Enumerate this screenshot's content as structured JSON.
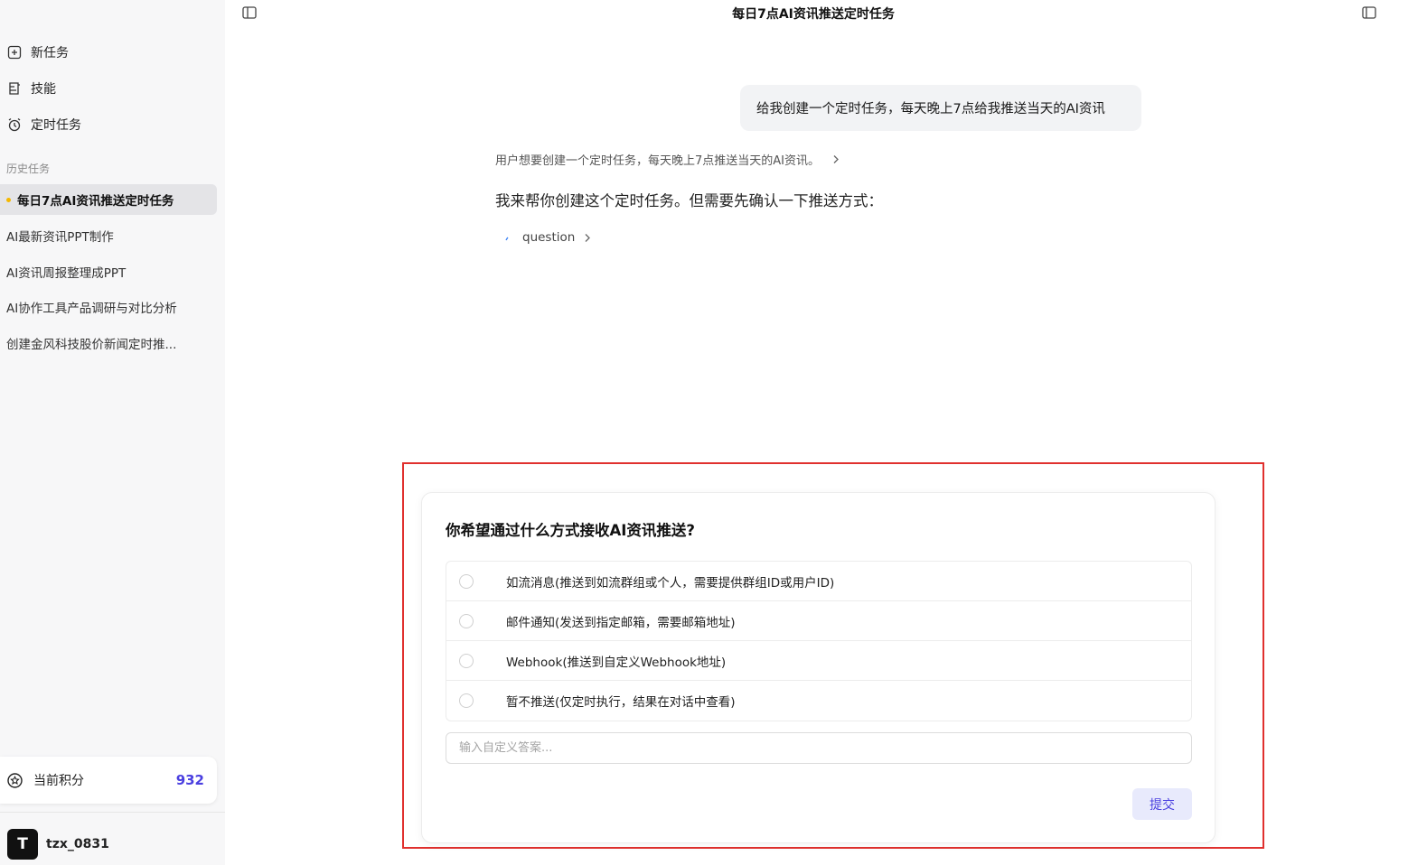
{
  "sidebar": {
    "nav": [
      {
        "label": "新任务",
        "icon": "plus-square-icon"
      },
      {
        "label": "技能",
        "icon": "skills-icon"
      },
      {
        "label": "定时任务",
        "icon": "alarm-clock-icon"
      }
    ],
    "history_label": "历史任务",
    "history": [
      {
        "label": "每日7点AI资讯推送定时任务",
        "active": true
      },
      {
        "label": "AI最新资讯PPT制作"
      },
      {
        "label": "AI资讯周报整理成PPT"
      },
      {
        "label": "AI协作工具产品调研与对比分析"
      },
      {
        "label": "创建金风科技股价新闻定时推..."
      }
    ],
    "points": {
      "label": "当前积分",
      "value": "932",
      "icon": "badge-star-icon"
    },
    "user": {
      "avatar_letter": "T",
      "name": "tzx_0831"
    }
  },
  "header": {
    "title": "每日7点AI资讯推送定时任务"
  },
  "chat": {
    "user_message": "给我创建一个定时任务，每天晚上7点给我推送当天的AI资讯",
    "thinking": "用户想要创建一个定时任务，每天晚上7点推送当天的AI资讯。",
    "reply": "我来帮你创建这个定时任务。但需要先确认一下推送方式：",
    "tool_label": "question"
  },
  "question_card": {
    "title": "你希望通过什么方式接收AI资讯推送?",
    "options": [
      "如流消息(推送到如流群组或个人，需要提供群组ID或用户ID)",
      "邮件通知(发送到指定邮箱，需要邮箱地址)",
      "Webhook(推送到自定义Webhook地址)",
      "暂不推送(仅定时执行，结果在对话中查看)"
    ],
    "custom_placeholder": "输入自定义答案...",
    "submit_label": "提交"
  },
  "colors": {
    "accent": "#4a3fe0",
    "highlight_border": "#e0302e",
    "active_dot": "#f5b800"
  }
}
